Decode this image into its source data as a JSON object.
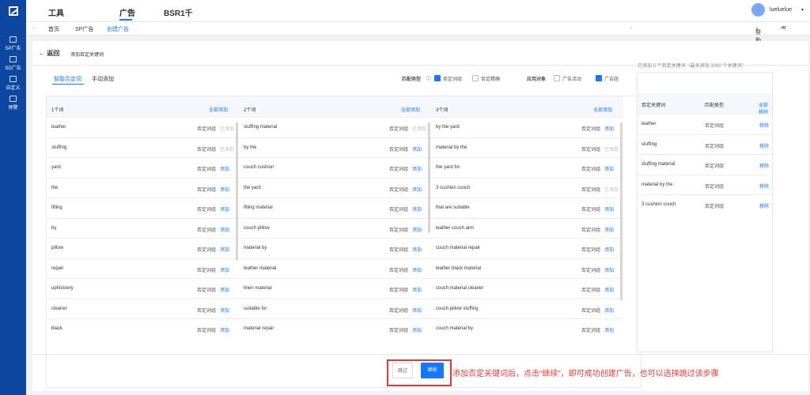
{
  "sidebar": {
    "items": [
      {
        "label": "SP广告",
        "icon": "sp-ad-icon"
      },
      {
        "label": "SD广告",
        "icon": "sd-ad-icon"
      },
      {
        "label": "自定义",
        "icon": "custom-icon"
      },
      {
        "label": "预警",
        "icon": "alert-icon"
      }
    ]
  },
  "top_nav": [
    "工具",
    "广告",
    "BSR1千"
  ],
  "user": {
    "name": "lueluelue",
    "caret": "▾"
  },
  "breadcrumbs": [
    "首页",
    "SP广告",
    "创建广告"
  ],
  "help": {
    "label": "帮助和服务",
    "collapse": "≪"
  },
  "page": {
    "back_label": "返回",
    "title": "添加否定关键词",
    "tabs": [
      "智能否定词",
      "手动添加"
    ],
    "match_type_label": "匹配类型",
    "match_options": [
      {
        "label": "否定词组",
        "checked": true
      },
      {
        "label": "否定精确",
        "checked": false
      }
    ],
    "apply_target_label": "应用对象",
    "apply_options": [
      {
        "label": "广告活动",
        "checked": false
      },
      {
        "label": "广告组",
        "checked": true
      }
    ]
  },
  "columns": [
    {
      "header": "1个词",
      "add_all": "全部添加",
      "rows": [
        {
          "keyword": "leather",
          "match": "否定词组",
          "action": "已添加",
          "added": true
        },
        {
          "keyword": "stuffing",
          "match": "否定词组",
          "action": "已添加",
          "added": true
        },
        {
          "keyword": "yard",
          "match": "否定词组",
          "action": "添加",
          "added": false
        },
        {
          "keyword": "the",
          "match": "否定词组",
          "action": "添加",
          "added": false
        },
        {
          "keyword": "filling",
          "match": "否定词组",
          "action": "添加",
          "added": false
        },
        {
          "keyword": "by",
          "match": "否定词组",
          "action": "添加",
          "added": false
        },
        {
          "keyword": "pillow",
          "match": "否定词组",
          "action": "添加",
          "added": false
        },
        {
          "keyword": "repair",
          "match": "否定词组",
          "action": "添加",
          "added": false
        },
        {
          "keyword": "upholstery",
          "match": "否定词组",
          "action": "添加",
          "added": false
        },
        {
          "keyword": "cleaner",
          "match": "否定词组",
          "action": "添加",
          "added": false
        },
        {
          "keyword": "black",
          "match": "否定词组",
          "action": "添加",
          "added": false
        }
      ]
    },
    {
      "header": "2个词",
      "add_all": "全部添加",
      "rows": [
        {
          "keyword": "stuffing material",
          "match": "否定词组",
          "action": "已添加",
          "added": true
        },
        {
          "keyword": "by the",
          "match": "否定词组",
          "action": "添加",
          "added": false
        },
        {
          "keyword": "couch cushion",
          "match": "否定词组",
          "action": "添加",
          "added": false
        },
        {
          "keyword": "the yard",
          "match": "否定词组",
          "action": "添加",
          "added": false
        },
        {
          "keyword": "filling material",
          "match": "否定词组",
          "action": "添加",
          "added": false
        },
        {
          "keyword": "couch pillow",
          "match": "否定词组",
          "action": "添加",
          "added": false
        },
        {
          "keyword": "material by",
          "match": "否定词组",
          "action": "添加",
          "added": false
        },
        {
          "keyword": "leather material",
          "match": "否定词组",
          "action": "添加",
          "added": false
        },
        {
          "keyword": "linen material",
          "match": "否定词组",
          "action": "添加",
          "added": false
        },
        {
          "keyword": "suitable for",
          "match": "否定词组",
          "action": "添加",
          "added": false
        },
        {
          "keyword": "material repair",
          "match": "否定词组",
          "action": "添加",
          "added": false
        }
      ]
    },
    {
      "header": "3个词",
      "add_all": "全部添加",
      "rows": [
        {
          "keyword": "by the yard",
          "match": "否定词组",
          "action": "添加",
          "added": false
        },
        {
          "keyword": "material by the",
          "match": "否定词组",
          "action": "已添加",
          "added": true
        },
        {
          "keyword": "the yard for",
          "match": "否定词组",
          "action": "添加",
          "added": false
        },
        {
          "keyword": "3 cushion couch",
          "match": "否定词组",
          "action": "已添加",
          "added": true
        },
        {
          "keyword": "that are suitable",
          "match": "否定词组",
          "action": "添加",
          "added": false
        },
        {
          "keyword": "leather couch arm",
          "match": "否定词组",
          "action": "添加",
          "added": false
        },
        {
          "keyword": "couch material repair",
          "match": "否定词组",
          "action": "添加",
          "added": false
        },
        {
          "keyword": "leather black material",
          "match": "否定词组",
          "action": "添加",
          "added": false
        },
        {
          "keyword": "couch material cleaner",
          "match": "否定词组",
          "action": "添加",
          "added": false
        },
        {
          "keyword": "couch pillow stuffing",
          "match": "否定词组",
          "action": "添加",
          "added": false
        },
        {
          "keyword": "couch material by",
          "match": "否定词组",
          "action": "添加",
          "added": false
        }
      ]
    }
  ],
  "selected": {
    "summary": "已添加 5 个否定关键词（最多添加 1000 个关键词）",
    "headers": {
      "keyword": "否定关键词",
      "match": "匹配类型",
      "remove_all": "全部移除"
    },
    "rows": [
      {
        "keyword": "leather",
        "match": "否定词组",
        "remove": "移除"
      },
      {
        "keyword": "stuffing",
        "match": "否定词组",
        "remove": "移除"
      },
      {
        "keyword": "stuffing material",
        "match": "否定词组",
        "remove": "移除"
      },
      {
        "keyword": "material by the",
        "match": "否定词组",
        "remove": "移除"
      },
      {
        "keyword": "3 cushion couch",
        "match": "否定词组",
        "remove": "移除"
      }
    ]
  },
  "footer": {
    "skip_label": "跳过",
    "continue_label": "继续",
    "notice": "添加否定关键词后，点击“继续”，即可成功创建广告，也可以选择跳过该步骤"
  },
  "colors": {
    "accent": "#1677ff",
    "sidebar": "#0d47a1",
    "notice": "#e53935"
  }
}
